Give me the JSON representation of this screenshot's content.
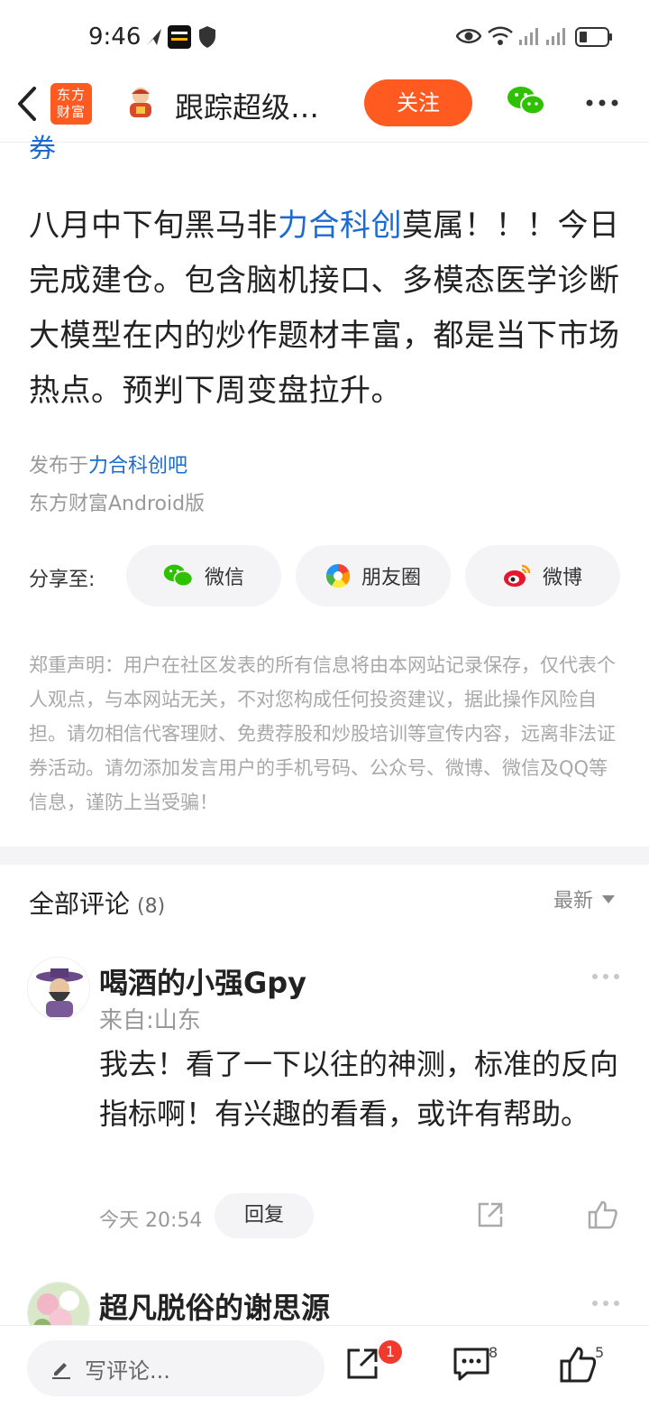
{
  "status_bar": {
    "time": "9:46"
  },
  "nav": {
    "logo_text_line1": "东方",
    "logo_text_line2": "财富",
    "title": "跟踪超级…",
    "follow_label": "关注"
  },
  "post": {
    "clipped_text": "券",
    "body_prefix": "八月中下旬黑马非",
    "stock_name": "力合科创",
    "body_suffix": "莫属！！！今日完成建仓。包含脑机接口、多模态医学诊断大模型在内的炒作题材丰富，都是当下市场热点。预判下周变盘拉升。",
    "published_prefix": "发布于",
    "published_forum": "力合科创吧",
    "client": "东方财富Android版"
  },
  "share": {
    "label": "分享至:",
    "targets": [
      {
        "label": "微信",
        "icon": "wechat-icon"
      },
      {
        "label": "朋友圈",
        "icon": "moments-icon"
      },
      {
        "label": "微博",
        "icon": "weibo-icon"
      }
    ]
  },
  "disclaimer": "郑重声明：用户在社区发表的所有信息将由本网站记录保存，仅代表个人观点，与本网站无关，不对您构成任何投资建议，据此操作风险自担。请勿相信代客理财、免费荐股和炒股培训等宣传内容，远离非法证券活动。请勿添加发言用户的手机号码、公众号、微博、微信及QQ等信息，谨防上当受骗！",
  "comments": {
    "title": "全部评论",
    "count": "(8)",
    "sort_label": "最新",
    "items": [
      {
        "username": "喝酒的小强Gpy",
        "location": "来自:山东",
        "text": "我去！看了一下以往的神测，标准的反向指标啊！有兴趣的看看，或许有帮助。",
        "time": "今天 20:54",
        "reply_label": "回复"
      },
      {
        "username": "超凡脱俗的谢思源"
      }
    ]
  },
  "bottom_bar": {
    "input_placeholder": "写评论...",
    "share_badge": "1",
    "comment_count": "8",
    "like_count": "5"
  },
  "colors": {
    "brand_orange": "#ff5a1f",
    "link_blue": "#1d6ad1",
    "badge_red": "#f03a2e",
    "wechat_green": "#2dc100"
  }
}
